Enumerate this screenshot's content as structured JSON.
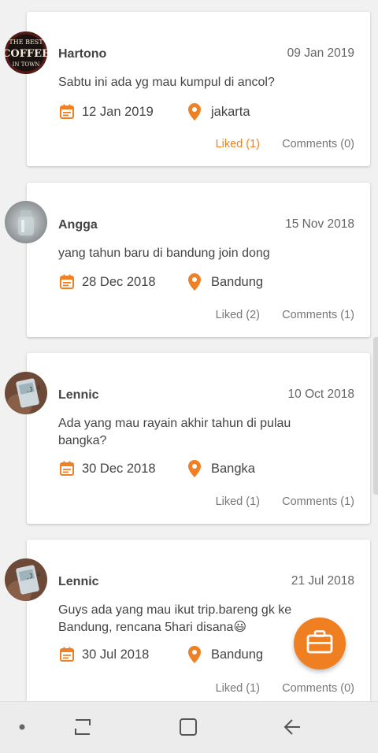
{
  "posts": [
    {
      "name": "Hartono",
      "date": "09 Jan 2019",
      "message": "Sabtu ini ada yg mau kumpul di ancol?",
      "event_date": "12 Jan 2019",
      "location": "jakarta",
      "liked": "Liked (1)",
      "comments": "Comments (0)",
      "liked_active": true
    },
    {
      "name": "Angga",
      "date": "15 Nov 2018",
      "message": "yang tahun baru di bandung join dong",
      "event_date": "28 Dec 2018",
      "location": "Bandung",
      "liked": "Liked (2)",
      "comments": "Comments (1)",
      "liked_active": false
    },
    {
      "name": "Lennic",
      "date": "10 Oct 2018",
      "message": "Ada yang mau rayain akhir tahun di pulau bangka?",
      "event_date": "30 Dec 2018",
      "location": "Bangka",
      "liked": "Liked (1)",
      "comments": "Comments (1)",
      "liked_active": false
    },
    {
      "name": "Lennic",
      "date": "21 Jul 2018",
      "message": "Guys ada yang mau ikut trip.bareng gk ke Bandung, rencana 5hari disana😃",
      "event_date": "30 Jul 2018",
      "location": "Bandung",
      "liked": "Liked (1)",
      "comments": "Comments (0)",
      "liked_active": false
    }
  ],
  "avatar_text": [
    "THE BEST",
    "COFFEE",
    "IN TOWN"
  ],
  "icons": {
    "event": "calendar-icon",
    "location": "location-pin-icon",
    "fab": "briefcase-icon"
  },
  "colors": {
    "accent": "#f08024",
    "fab": "#f07f22"
  }
}
